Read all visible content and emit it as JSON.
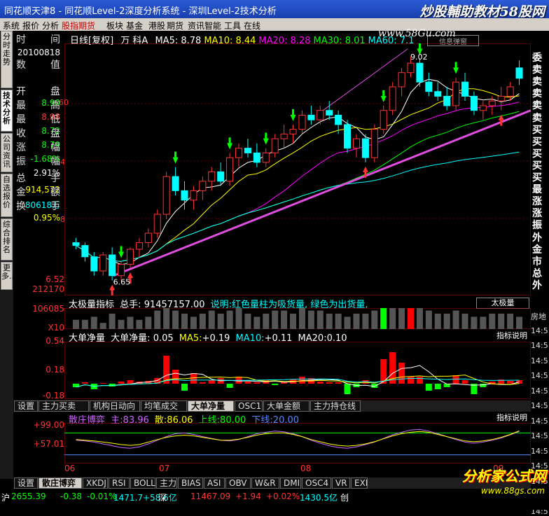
{
  "window": {
    "title": "同花顺天津8 - 同花顺Level-2深度分析系统 - 深圳Level-2技术分析",
    "watermark": "炒股輔助教材58股网",
    "watermark_url": "www.58Gu.com"
  },
  "menu": [
    "系统",
    "报价",
    "分析",
    "股指期货",
    "板块",
    "基金",
    "港股",
    "期货",
    "资讯",
    "智能",
    "工具",
    "在线"
  ],
  "vtabs": [
    "分时走势",
    "技术分析",
    "公司资讯",
    "自选报价",
    "综合排名",
    "更多..."
  ],
  "info": {
    "rows": [
      {
        "l": "时",
        "r": "间",
        "v": ""
      },
      {
        "l": "",
        "r": "",
        "v": "20100818"
      },
      {
        "l": "数",
        "r": "值",
        "v": ""
      },
      {
        "l": "开",
        "r": "盘",
        "v": "8.90"
      },
      {
        "l": "最",
        "r": "高",
        "v": "8.98"
      },
      {
        "l": "最",
        "r": "低",
        "v": "8.72"
      },
      {
        "l": "收",
        "r": "盘",
        "v": "8.79"
      },
      {
        "l": "涨",
        "r": "幅",
        "v": "-1.68%"
      },
      {
        "l": "振",
        "r": "幅",
        "v": "2.91%"
      },
      {
        "l": "总",
        "r": "手",
        "v": "914,572"
      },
      {
        "l": "金",
        "r": "额",
        "v": "80618万"
      },
      {
        "l": "换",
        "r": "手",
        "v": "0.95%"
      }
    ],
    "colors": [
      "#fff",
      "#fff",
      "#fff",
      "#0f0",
      "#f33",
      "#0f0",
      "#0f0",
      "#0f0",
      "#fff",
      "#ff0",
      "#0ff",
      "#ff0"
    ]
  },
  "main_chart": {
    "header_label": "日线[复权]",
    "stock_name": "万 科A",
    "ma": [
      {
        "label": "MA5:",
        "value": "8.78",
        "color": "#fff"
      },
      {
        "label": "MA10:",
        "value": "8.44",
        "color": "#ff0"
      },
      {
        "label": "MA20:",
        "value": "8.28",
        "color": "#f0f"
      },
      {
        "label": "MA30:",
        "value": "8.01",
        "color": "#0f0"
      },
      {
        "label": "MA60:",
        "value": "7.1",
        "color": "#0ff"
      }
    ],
    "hi_label": "9.02",
    "lo_label": "6.65",
    "right_tag": "信息弹窗",
    "yticks": [
      "60",
      "4",
      "8"
    ]
  },
  "chart_data": {
    "type": "candlestick",
    "dates": [
      "06",
      "07",
      "08",
      "09"
    ],
    "candles": [
      [
        7.05,
        7.1,
        6.98,
        7.02
      ],
      [
        7.02,
        7.05,
        6.85,
        6.9
      ],
      [
        6.9,
        6.95,
        6.7,
        6.75
      ],
      [
        6.75,
        6.95,
        6.7,
        6.92
      ],
      [
        6.92,
        7.0,
        6.65,
        6.7
      ],
      [
        6.7,
        6.85,
        6.65,
        6.82
      ],
      [
        6.82,
        7.0,
        6.78,
        6.98
      ],
      [
        6.98,
        7.1,
        6.9,
        7.05
      ],
      [
        7.05,
        7.2,
        7.0,
        7.15
      ],
      [
        7.15,
        7.4,
        7.1,
        7.35
      ],
      [
        7.35,
        7.8,
        7.3,
        7.75
      ],
      [
        7.75,
        7.85,
        7.55,
        7.6
      ],
      [
        7.6,
        7.7,
        7.4,
        7.5
      ],
      [
        7.5,
        7.65,
        7.4,
        7.6
      ],
      [
        7.6,
        7.75,
        7.5,
        7.7
      ],
      [
        7.7,
        7.85,
        7.6,
        7.8
      ],
      [
        7.8,
        7.9,
        7.65,
        7.7
      ],
      [
        7.7,
        8.0,
        7.65,
        7.95
      ],
      [
        7.95,
        8.1,
        7.85,
        8.05
      ],
      [
        8.05,
        8.15,
        7.95,
        8.0
      ],
      [
        8.0,
        8.1,
        7.85,
        7.9
      ],
      [
        7.9,
        8.05,
        7.85,
        8.0
      ],
      [
        8.0,
        8.2,
        7.95,
        8.15
      ],
      [
        8.15,
        8.3,
        8.05,
        8.2
      ],
      [
        8.2,
        8.3,
        8.1,
        8.25
      ],
      [
        8.25,
        8.45,
        8.2,
        8.4
      ],
      [
        8.4,
        8.5,
        8.3,
        8.35
      ],
      [
        8.35,
        8.5,
        8.3,
        8.45
      ],
      [
        8.45,
        8.55,
        8.35,
        8.4
      ],
      [
        8.4,
        8.45,
        8.2,
        8.3
      ],
      [
        8.3,
        8.35,
        8.0,
        8.05
      ],
      [
        8.05,
        8.2,
        7.95,
        8.15
      ],
      [
        8.15,
        8.2,
        7.9,
        7.95
      ],
      [
        7.95,
        8.3,
        7.9,
        8.25
      ],
      [
        8.25,
        8.5,
        8.2,
        8.45
      ],
      [
        8.45,
        8.75,
        8.4,
        8.7
      ],
      [
        8.7,
        8.9,
        8.6,
        8.85
      ],
      [
        8.85,
        9.02,
        8.8,
        8.95
      ],
      [
        8.95,
        9.0,
        8.7,
        8.75
      ],
      [
        8.75,
        8.85,
        8.6,
        8.65
      ],
      [
        8.65,
        8.75,
        8.55,
        8.6
      ],
      [
        8.6,
        8.7,
        8.45,
        8.5
      ],
      [
        8.5,
        8.8,
        8.45,
        8.75
      ],
      [
        8.75,
        8.85,
        8.55,
        8.6
      ],
      [
        8.6,
        8.65,
        8.4,
        8.45
      ],
      [
        8.45,
        8.55,
        8.35,
        8.5
      ],
      [
        8.5,
        8.6,
        8.4,
        8.55
      ],
      [
        8.55,
        8.7,
        8.45,
        8.6
      ],
      [
        8.6,
        8.75,
        8.55,
        8.7
      ],
      [
        8.9,
        8.98,
        8.72,
        8.79
      ]
    ],
    "volume": {
      "title": "太极量指标",
      "total_label": "总手:",
      "total": "91457157.00",
      "note": "说明:红色量柱为吸货量, 绿色为出货量,",
      "btn": "太极量",
      "yticks": [
        "212170",
        "106085",
        "X10"
      ],
      "values": [
        3,
        3,
        4,
        2,
        5,
        3,
        4,
        3,
        4,
        6,
        8,
        6,
        5,
        4,
        5,
        6,
        5,
        6,
        7,
        5,
        4,
        5,
        6,
        6,
        5,
        7,
        6,
        6,
        5,
        5,
        4,
        5,
        5,
        6,
        7,
        8,
        9,
        10,
        7,
        6,
        5,
        5,
        6,
        5,
        4,
        4,
        5,
        5,
        5,
        4
      ],
      "colors": [
        "g",
        "g",
        "g",
        "g",
        "g",
        "g",
        "g",
        "g",
        "g",
        "g",
        "g",
        "g",
        "g",
        "g",
        "g",
        "g",
        "g",
        "g",
        "g",
        "g",
        "g",
        "g",
        "g",
        "g",
        "g",
        "g",
        "g",
        "g",
        "g",
        "g",
        "g",
        "g",
        "g",
        "g",
        "G",
        "g",
        "g",
        "R",
        "g",
        "g",
        "g",
        "g",
        "g",
        "g",
        "g",
        "g",
        "g",
        "g",
        "g",
        "g"
      ]
    },
    "bigorder": {
      "title": "大单净量",
      "sub": "大单净量:",
      "sub_v": "0.05",
      "ma5": "+0.19",
      "ma10": "+0.11",
      "ma20": "0.10",
      "btn": "指标说明",
      "yticks": [
        "0.54",
        "0.18",
        "-0.18"
      ],
      "values": [
        -0.05,
        0.02,
        -0.08,
        0.01,
        -0.04,
        0.03,
        0.05,
        0.03,
        0.04,
        0.08,
        0.4,
        0.2,
        -0.1,
        0.15,
        0.02,
        0.05,
        0.08,
        -0.06,
        0.1,
        0.03,
        0.02,
        0.05,
        -0.02,
        0.03,
        0.06,
        0.1,
        0.08,
        0.03,
        0.02,
        0.02,
        -0.15,
        -0.05,
        0.05,
        -0.06,
        0.35,
        0.45,
        0.3,
        0.1,
        0.1,
        -0.1,
        -0.08,
        -0.05,
        0.12,
        0.05,
        -0.15,
        -0.05,
        0.03,
        0.06,
        0.04,
        0.05
      ]
    },
    "osc": {
      "title": "散庄博弈",
      "main_l": "主:",
      "main_v": "83.96",
      "san_l": "散:",
      "san_v": "86.06",
      "up_l": "上线:",
      "up_v": "80.00",
      "dn_l": "下线:",
      "dn_v": "20.00",
      "btn": "指标说明",
      "yticks": [
        "+99.00",
        "+57.01"
      ],
      "main": [
        60,
        58,
        55,
        50,
        45,
        40,
        38,
        42,
        50,
        60,
        70,
        78,
        80,
        76,
        70,
        65,
        60,
        58,
        62,
        70,
        78,
        82,
        85,
        83,
        78,
        70,
        60,
        52,
        45,
        40,
        38,
        42,
        48,
        55,
        65,
        75,
        82,
        88,
        90,
        85,
        78,
        70,
        62,
        55,
        52,
        55,
        60,
        66,
        75,
        84
      ],
      "san": [
        62,
        60,
        58,
        55,
        52,
        48,
        46,
        48,
        55,
        62,
        68,
        72,
        74,
        72,
        68,
        64,
        60,
        60,
        63,
        68,
        74,
        78,
        80,
        80,
        76,
        70,
        62,
        56,
        50,
        46,
        44,
        46,
        50,
        56,
        64,
        72,
        78,
        82,
        84,
        82,
        76,
        70,
        64,
        58,
        56,
        58,
        62,
        68,
        76,
        86
      ]
    },
    "xticks": [
      "06",
      "07",
      "08",
      "09"
    ]
  },
  "bottom_tabs1": [
    "设置",
    "主力买卖",
    "机构日动向",
    "均笔成交",
    "大单净量",
    "OSC1",
    "大单金额",
    "主力持仓线"
  ],
  "bottom_tabs2": [
    "设置",
    "散庄博弈",
    "XKDJ",
    "RSI",
    "BOLL",
    "主力",
    "BIAS",
    "ASI",
    "OBV",
    "W&R",
    "DMI",
    "OSC4",
    "VR",
    "EXI"
  ],
  "right_col": [
    "委",
    "卖",
    "卖",
    "卖",
    "卖",
    "卖",
    "买",
    "买",
    "买",
    "买",
    "买",
    "最",
    "涨",
    "涨",
    "振",
    "外",
    "金",
    "市",
    "总",
    "外"
  ],
  "right_col2": [
    "房地",
    "14:5",
    "14:5",
    "14:5",
    "14:5",
    "14:5",
    "14:5",
    "14:5",
    "14:5",
    "14:5",
    "14:5",
    "14:5",
    "14:5",
    "14:5"
  ],
  "status": [
    {
      "t": "沪",
      "c": "#fff"
    },
    {
      "t": "2655.39",
      "c": "#0f0"
    },
    {
      "t": "-0.38",
      "c": "#0f0"
    },
    {
      "t": "-0.01%",
      "c": "#0f0"
    },
    {
      "t": "1471.7+58.6亿",
      "c": "#0ff"
    },
    {
      "t": "深",
      "c": "#fff"
    },
    {
      "t": "11467.09",
      "c": "#f33"
    },
    {
      "t": "+1.94",
      "c": "#f33"
    },
    {
      "t": "+0.02%",
      "c": "#f33"
    },
    {
      "t": "1430.5亿",
      "c": "#0ff"
    },
    {
      "t": "创",
      "c": "#fff"
    }
  ],
  "logo": "分析家公式网",
  "logo_url": "www.88gs.com"
}
